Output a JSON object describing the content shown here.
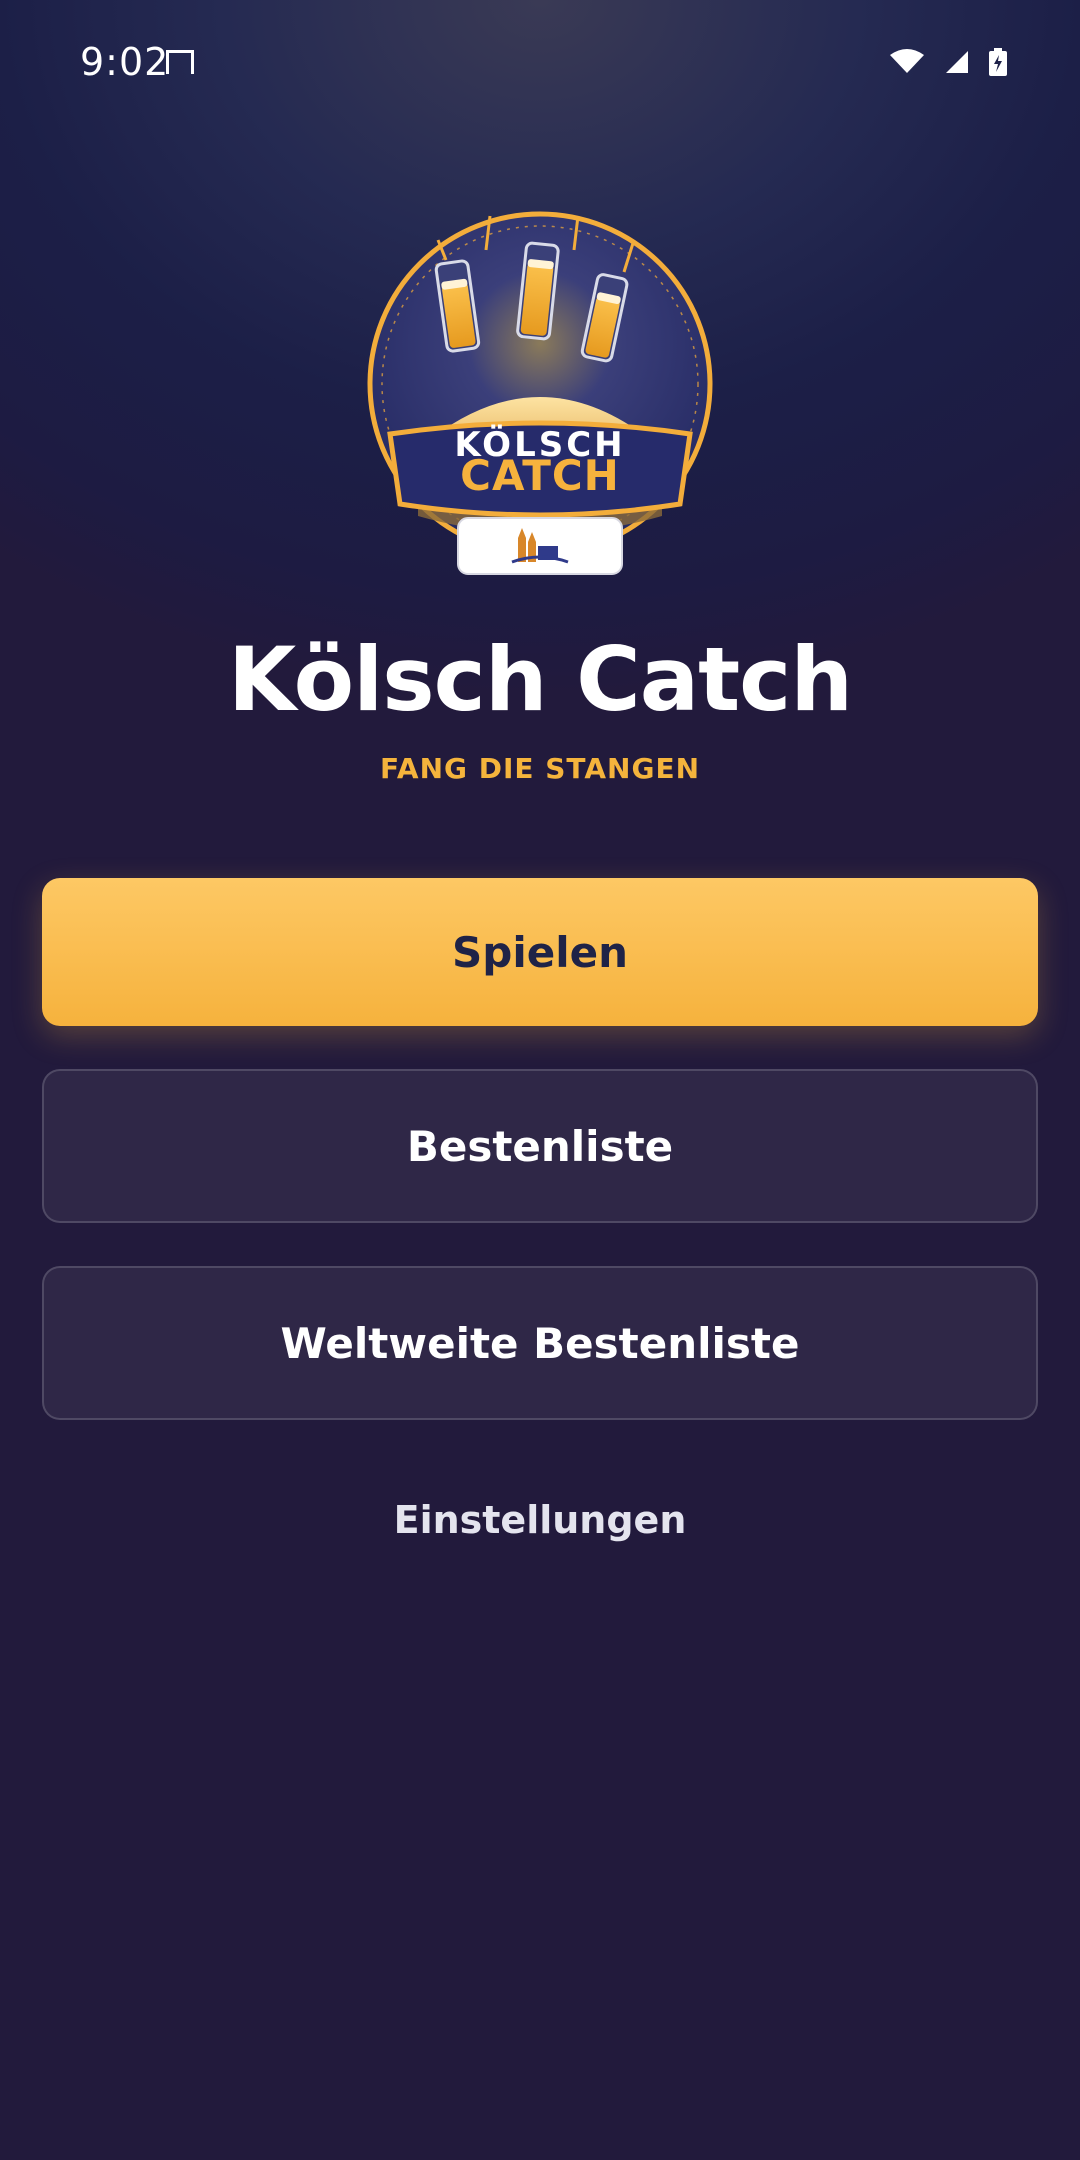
{
  "status_bar": {
    "time": "9:02",
    "icons": [
      "sim-card-icon",
      "wifi-icon",
      "signal-icon",
      "battery-charging-icon"
    ]
  },
  "logo": {
    "line1": "KÖLSCH",
    "line2": "CATCH",
    "icon": "cologne-cathedral-badge-icon"
  },
  "header": {
    "title": "Kölsch Catch",
    "subtitle": "FANG DIE STANGEN"
  },
  "menu": {
    "play_label": "Spielen",
    "leaderboard_label": "Bestenliste",
    "global_leaderboard_label": "Weltweite Bestenliste",
    "settings_label": "Einstellungen"
  },
  "colors": {
    "accent": "#f6b23d",
    "background": "#1e2149",
    "button_text_dark": "#1f2347"
  }
}
